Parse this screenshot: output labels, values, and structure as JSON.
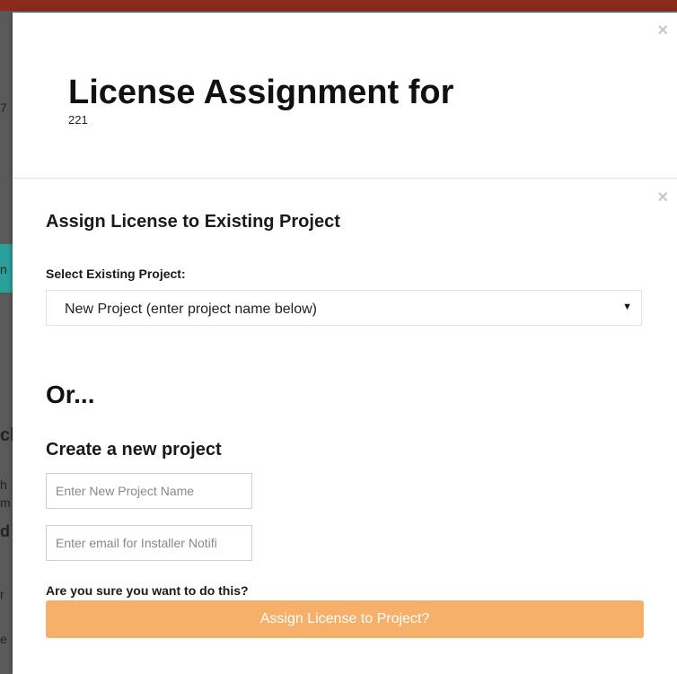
{
  "backdrop": {
    "fragments": [
      "7",
      "n",
      "cl",
      "h",
      "m",
      "d",
      "r",
      "e"
    ]
  },
  "modal": {
    "title": "License Assignment for",
    "subtitle": "221",
    "close_glyph": "×"
  },
  "assign_existing": {
    "title": "Assign License to Existing Project",
    "close_glyph": "×",
    "select_label": "Select Existing Project:",
    "select_value": "New Project (enter project name below)",
    "select_arrow": "▼"
  },
  "or_heading": "Or...",
  "create_new": {
    "title": "Create a new project",
    "project_name_placeholder": "Enter New Project Name",
    "email_placeholder": "Enter email for Installer Notifi"
  },
  "confirm": {
    "question": "Are you sure you want to do this?",
    "button_label": "Assign License to Project?"
  },
  "colors": {
    "top_bar": "#8a2b1c",
    "button": "#f6b06a",
    "teal": "#2aa198"
  }
}
